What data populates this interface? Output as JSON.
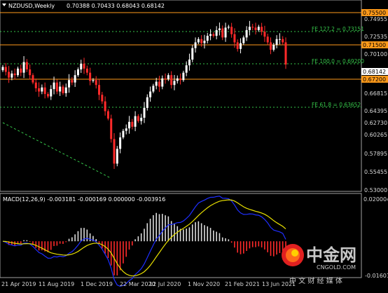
{
  "header": {
    "menu_icon": "dropdown-triangle-icon",
    "symbol": "NZDUSD,Weekly",
    "ohlc": "0.70388 0.70433 0.68043 0.68142"
  },
  "macd": {
    "label": "MACD(12,26,9) -0.003181 -0.000169 0.000000 -0.003916"
  },
  "price_axis": {
    "ticks": [
      "0.74955",
      "0.72535",
      "0.70100",
      "0.66815",
      "0.64395",
      "0.62730",
      "0.60265",
      "0.57895",
      "0.55455",
      "0.53000"
    ],
    "highlighted": [
      {
        "value": "0.75500",
        "bg": "#ff9a1a",
        "fg": "#000000"
      },
      {
        "value": "0.71500",
        "bg": "#ff9a1a",
        "fg": "#000000"
      },
      {
        "value": "0.68142",
        "bg": "#ffffff",
        "fg": "#000000"
      },
      {
        "value": "0.67200",
        "bg": "#ff9a1a",
        "fg": "#000000"
      }
    ]
  },
  "macd_axis": {
    "top": "0.020004",
    "bottom": "-0.016013"
  },
  "fib_labels": {
    "fe127": "FE 127.2 = 0.73151",
    "fe100": "FE 100.0 = 0.69200",
    "fe618": "FE 61.8 = 0.63652"
  },
  "date_axis": [
    "21 Apr 2019",
    "11 Aug 2019",
    "1 Dec 2019",
    "22 Mar 2020",
    "12 Jul 2020",
    "1 Nov 2020",
    "21 Feb 2021",
    "13 Jun 2021"
  ],
  "watermark": {
    "logo_icon": "cngold-logo-icon",
    "brand_cn": "中金网",
    "brand_en": "CNGOLD.COM",
    "slogan": "中 文 财 经 媒 体"
  },
  "colors": {
    "bull": "#ffffff",
    "bear": "#ff2a2a",
    "resistance": "#ff9a1a",
    "fib": "#36c64a",
    "macd_line": "#1f2fff",
    "signal_line": "#e8e000"
  },
  "chart_data": [
    {
      "type": "candlestick",
      "title": "NZDUSD,Weekly",
      "ylim": [
        0.527,
        0.758
      ],
      "horizontal_levels": [
        0.755,
        0.715,
        0.672
      ],
      "fib_levels": [
        0.73151,
        0.692,
        0.63652
      ],
      "last_price": 0.68142,
      "trend_line": [
        [
          0.64,
          0.545
        ]
      ],
      "close_series": [
        0.678,
        0.672,
        0.665,
        0.67,
        0.668,
        0.676,
        0.671,
        0.684,
        0.675,
        0.668,
        0.659,
        0.652,
        0.648,
        0.653,
        0.645,
        0.642,
        0.651,
        0.659,
        0.648,
        0.654,
        0.646,
        0.653,
        0.662,
        0.659,
        0.668,
        0.675,
        0.682,
        0.676,
        0.671,
        0.661,
        0.662,
        0.656,
        0.644,
        0.636,
        0.624,
        0.615,
        0.59,
        0.56,
        0.578,
        0.592,
        0.6,
        0.603,
        0.611,
        0.605,
        0.618,
        0.612,
        0.616,
        0.628,
        0.641,
        0.648,
        0.655,
        0.66,
        0.654,
        0.664,
        0.663,
        0.668,
        0.656,
        0.661,
        0.664,
        0.662,
        0.671,
        0.68,
        0.687,
        0.701,
        0.708,
        0.712,
        0.707,
        0.71,
        0.716,
        0.718,
        0.716,
        0.723,
        0.725,
        0.714,
        0.726,
        0.727,
        0.718,
        0.708,
        0.7,
        0.707,
        0.714,
        0.723,
        0.727,
        0.726,
        0.723,
        0.727,
        0.721,
        0.715,
        0.708,
        0.699,
        0.705,
        0.712,
        0.712,
        0.708,
        0.681
      ]
    },
    {
      "type": "macd",
      "title": "MACD(12,26,9)",
      "ylim": [
        -0.016013,
        0.020004
      ],
      "values": {
        "macd": -0.003181,
        "signal": -0.000169,
        "histogram": 0.0,
        "extra": -0.003916
      }
    }
  ]
}
